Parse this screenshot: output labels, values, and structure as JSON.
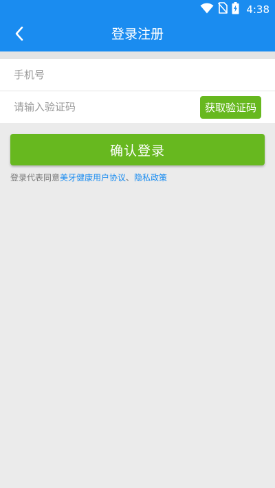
{
  "status_bar": {
    "time": "4:38",
    "icons": [
      "wifi-icon",
      "no-sim-icon",
      "battery-charging-icon"
    ]
  },
  "header": {
    "title": "登录注册",
    "back_icon": "chevron-left-icon"
  },
  "form": {
    "phone_placeholder": "手机号",
    "phone_value": "",
    "code_placeholder": "请输入验证码",
    "code_value": "",
    "get_code_label": "获取验证码"
  },
  "submit_label": "确认登录",
  "agreement": {
    "prefix": "登录代表同意",
    "user_agreement": "美牙健康用户协议",
    "separator": "、",
    "privacy_policy": "隐私政策"
  },
  "colors": {
    "primary_blue": "#1a8cf0",
    "accent_green": "#67b81f",
    "background": "#ebebeb"
  }
}
